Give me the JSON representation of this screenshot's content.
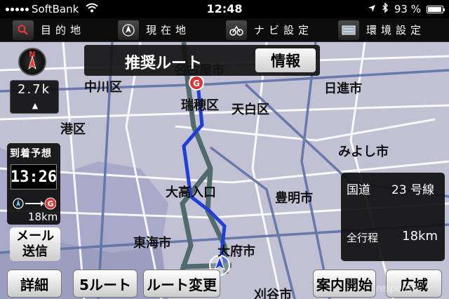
{
  "status_bar": {
    "carrier": "SoftBank",
    "time": "12:48",
    "battery": "93 %",
    "battery_level": 0.93
  },
  "menu": [
    {
      "icon": "search-icon",
      "label": "目的地"
    },
    {
      "icon": "current-location-icon",
      "label": "現在地"
    },
    {
      "icon": "nav-settings-icon",
      "label": "ナビ設定"
    },
    {
      "icon": "environment-settings-icon",
      "label": "環境設定"
    }
  ],
  "map": {
    "places": [
      "名古屋市",
      "中川区",
      "瑞穂区",
      "天白区",
      "日進市",
      "港区",
      "みよし市",
      "大高入口",
      "豊明市",
      "東海市",
      "大府市",
      "刈谷市"
    ],
    "colors": {
      "background": "#c2c1d4",
      "route": "#1f3fd6",
      "highway": "#4f6b6b",
      "road": "#ffffff"
    }
  },
  "route_banner": {
    "title": "推奨ルート",
    "info_button": "情報"
  },
  "compass": {
    "label": "N"
  },
  "scale": {
    "value": "2.7k",
    "zoom_in_label": "▲"
  },
  "eta": {
    "label": "到着予想",
    "time": "13:26",
    "distance": "18km"
  },
  "mail_button": {
    "line1": "メール",
    "line2": "送信"
  },
  "road_info": {
    "road_type": "国道",
    "road_number": "23 号線",
    "total_label": "全行程",
    "total_value": "18km"
  },
  "bottom_buttons": {
    "details": "詳細",
    "five_routes": "5ルート",
    "change_route": "ルート変更",
    "start_guidance": "案内開始",
    "wide_area": "広域"
  },
  "watermark": "response"
}
